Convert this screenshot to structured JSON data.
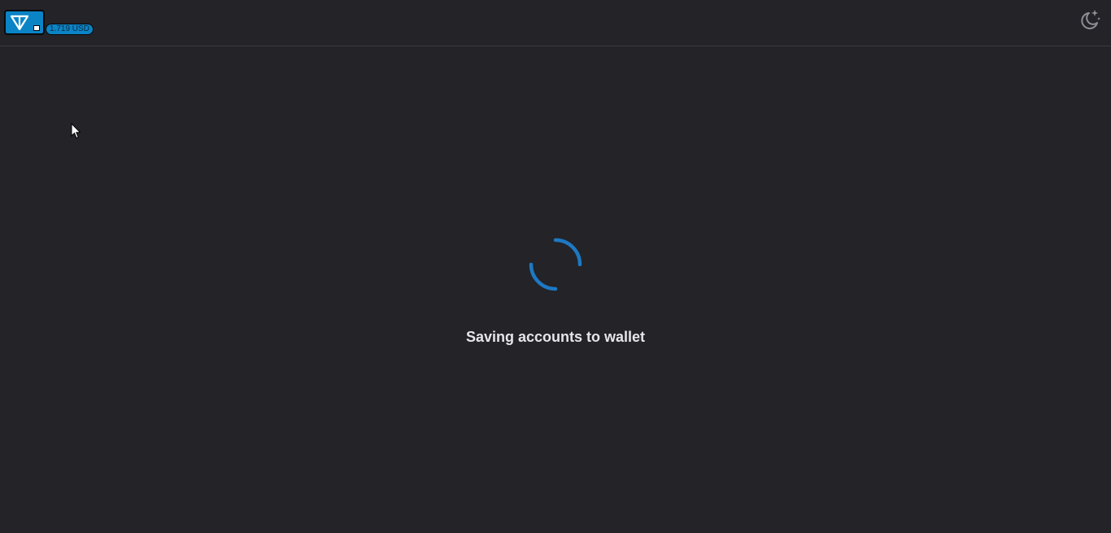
{
  "header": {
    "logo_icon": "ton-diamond-icon",
    "price_label": "1.719 USD",
    "theme_toggle_icon": "moon-star-icon"
  },
  "main": {
    "spinner_icon": "loading-spinner-icon",
    "status_text": "Saving accounts to wallet"
  },
  "colors": {
    "background": "#232328",
    "accent": "#0b84c6",
    "spinner": "#1e78c2",
    "text": "#e6e6e9"
  }
}
